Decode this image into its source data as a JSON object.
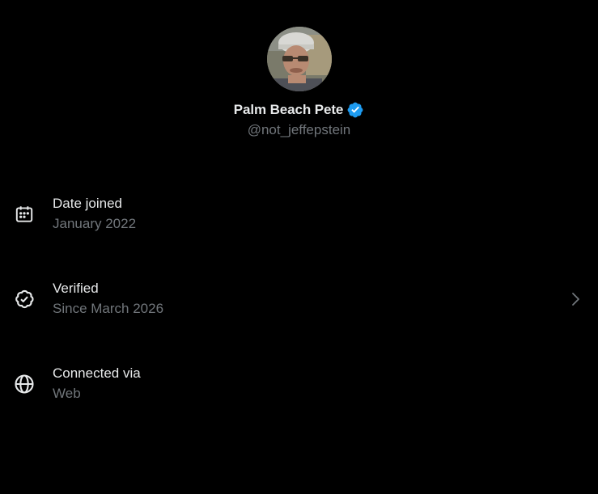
{
  "profile": {
    "display_name": "Palm Beach Pete",
    "handle": "@not_jeffepstein",
    "verified": true,
    "verified_color": "#1d9bf0"
  },
  "info": {
    "items": [
      {
        "icon": "calendar-icon",
        "label": "Date joined",
        "value": "January 2022",
        "has_chevron": false
      },
      {
        "icon": "verified-check-icon",
        "label": "Verified",
        "value": "Since March 2026",
        "has_chevron": true
      },
      {
        "icon": "globe-icon",
        "label": "Connected via",
        "value": "Web",
        "has_chevron": false
      }
    ]
  },
  "colors": {
    "background": "#000000",
    "primary_text": "#e7e9ea",
    "secondary_text": "#71767b",
    "accent": "#1d9bf0"
  }
}
